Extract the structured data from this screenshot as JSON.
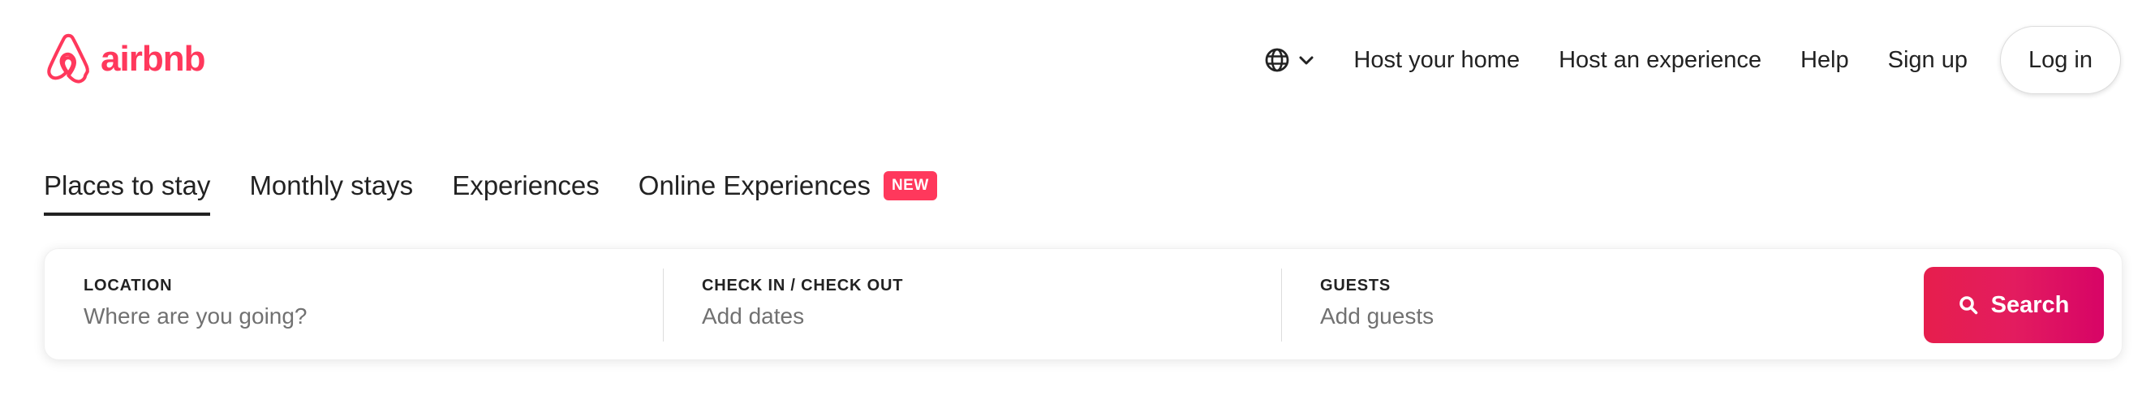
{
  "brand": {
    "name": "airbnb",
    "color": "#ff385c",
    "logo_icon": "airbnb-belo-icon"
  },
  "header": {
    "language_icon": "globe-icon",
    "dropdown_icon": "chevron-down-icon",
    "links": [
      {
        "label": "Host your home"
      },
      {
        "label": "Host an experience"
      },
      {
        "label": "Help"
      },
      {
        "label": "Sign up"
      }
    ],
    "login_label": "Log in"
  },
  "tabs": [
    {
      "label": "Places to stay",
      "active": true
    },
    {
      "label": "Monthly stays",
      "active": false
    },
    {
      "label": "Experiences",
      "active": false
    },
    {
      "label": "Online Experiences",
      "active": false,
      "badge": "NEW"
    }
  ],
  "search": {
    "location": {
      "label": "LOCATION",
      "placeholder": "Where are you going?",
      "value": ""
    },
    "dates": {
      "label": "CHECK IN / CHECK OUT",
      "placeholder": "Add dates",
      "value": ""
    },
    "guests": {
      "label": "GUESTS",
      "placeholder": "Add guests",
      "value": ""
    },
    "button_label": "Search",
    "button_icon": "search-icon",
    "button_color": "#e31c5f"
  }
}
